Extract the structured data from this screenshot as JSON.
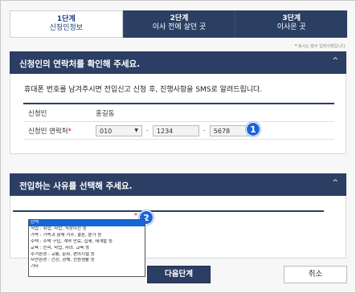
{
  "steps": [
    {
      "num": "1단계",
      "name": "신청인정보",
      "active": true
    },
    {
      "num": "2단계",
      "name": "이사 전에 살던 곳",
      "active": false
    },
    {
      "num": "3단계",
      "name": "이사온 곳",
      "active": false
    }
  ],
  "required_note": "표시는 필수 입력사항입니다.",
  "contact_section": {
    "title": "신청인의 연락처를 확인해 주세요.",
    "description": "휴대폰 번호를 남겨주시면 전입신고 신청 후, 진행사항을 SMS로 알려드립니다.",
    "name_label": "신청인",
    "name_value": "홍길동",
    "phone_label": "신청인 연락처",
    "phone_prefix": "010",
    "phone_mid": "1234",
    "phone_last": "5678",
    "badge": "1"
  },
  "reason_section": {
    "title": "전입하는 사유를 선택해 주세요.",
    "badge": "2",
    "options": [
      "선택",
      "직업 : 취업, 사업, 직장이전 등",
      "가족 : 가족과 함께 거주, 결혼, 분가 등",
      "주택 : 주택 구입, 계약 만료, 집세, 재개발 등",
      "교육 : 진학, 학업, 자녀, 교육 등",
      "주거환경 : 교통, 문화, 편의시설 등",
      "자연환경 : 건강, 공해, 전원생활 등",
      "기타"
    ],
    "selected_index": 0
  },
  "buttons": {
    "next": "다음단계",
    "cancel": "취소"
  },
  "caret_up": "^",
  "colors": {
    "header_navy": "#2c3e63",
    "badge_blue": "#1d63d8",
    "required_red": "#dd0000"
  }
}
